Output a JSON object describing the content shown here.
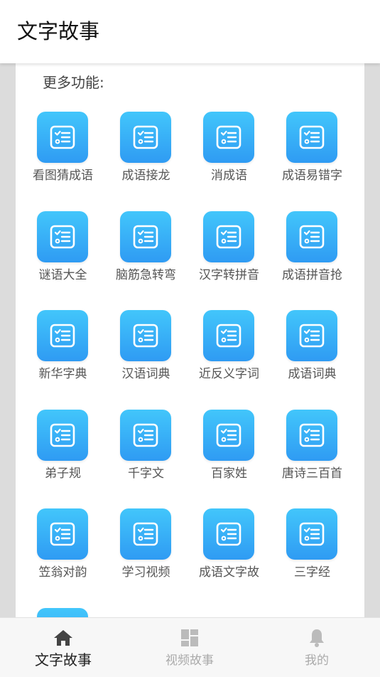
{
  "app_bar": {
    "title": "文字故事"
  },
  "section": {
    "title": "更多功能:"
  },
  "features": [
    "看图猜成语",
    "成语接龙",
    "消成语",
    "成语易错字",
    "谜语大全",
    "脑筋急转弯",
    "汉字转拼音",
    "成语拼音抢",
    "新华字典",
    "汉语词典",
    "近反义字词",
    "成语词典",
    "弟子规",
    "千字文",
    "百家姓",
    "唐诗三百首",
    "笠翁对韵",
    "学习视频",
    "成语文字故",
    "三字经",
    ""
  ],
  "feature_icon": "checklist-icon",
  "colors": {
    "icon_gradient_top": "#42c6fb",
    "icon_gradient_bottom": "#2f9bf3",
    "nav_active": "#222222",
    "nav_inactive": "#aaaaaa"
  },
  "bottom_nav": {
    "items": [
      {
        "label": "文字故事",
        "icon": "home-icon",
        "active": true
      },
      {
        "label": "视频故事",
        "icon": "dashboard-icon",
        "active": false
      },
      {
        "label": "我的",
        "icon": "bell-icon",
        "active": false
      }
    ]
  }
}
